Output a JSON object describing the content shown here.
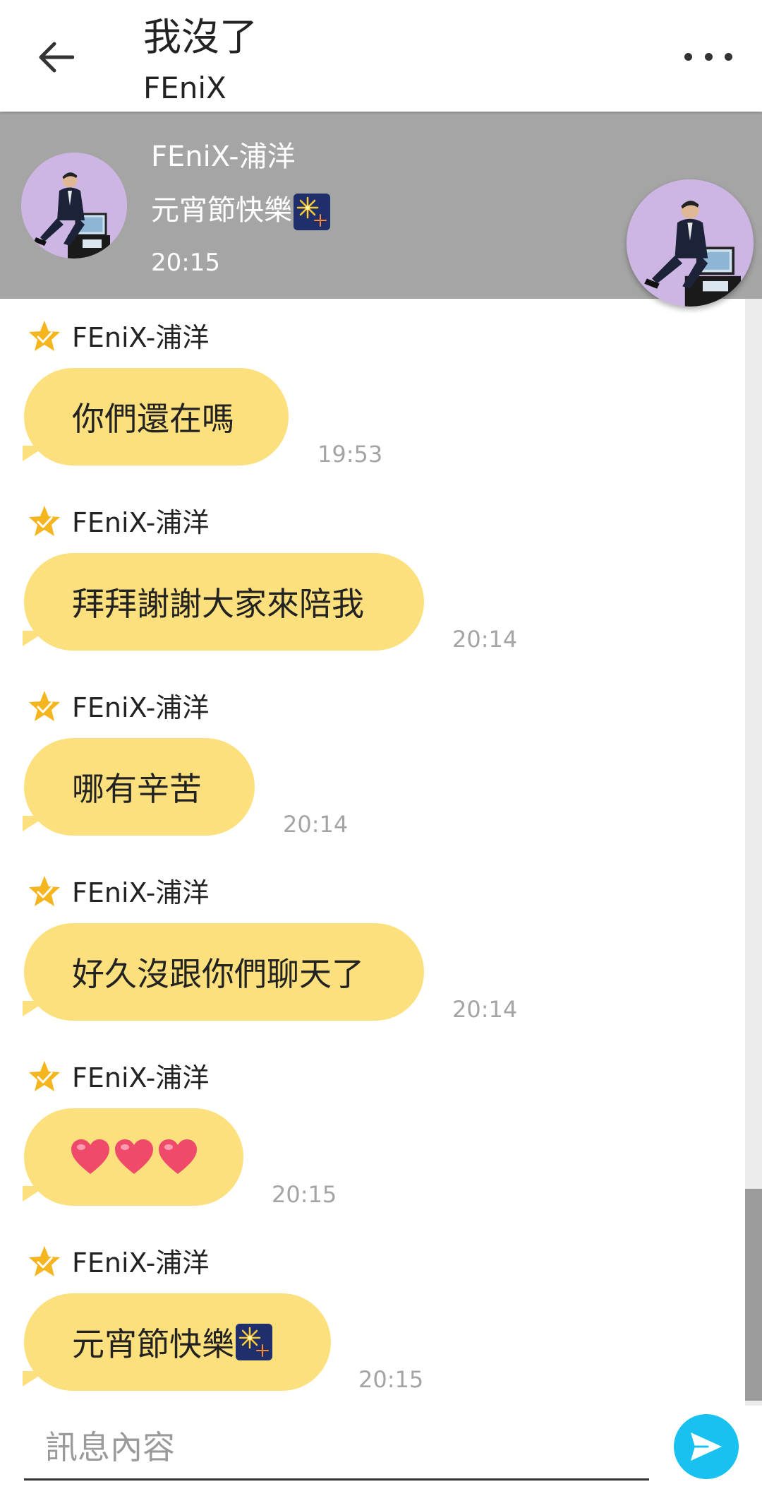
{
  "header": {
    "title": "我沒了",
    "subtitle": "FEniX",
    "back_icon": "arrow-left-icon",
    "more_icon": "more-horizontal-icon"
  },
  "pinned": {
    "name": "FEniX-浦洋",
    "text": "元宵節快樂",
    "text_emoji": "firework-icon",
    "time": "20:15"
  },
  "messages": [
    {
      "sender": "FEniX-浦洋",
      "text": "你們還在嗎",
      "time": "19:53"
    },
    {
      "sender": "FEniX-浦洋",
      "text": "拜拜謝謝大家來陪我",
      "time": "20:14"
    },
    {
      "sender": "FEniX-浦洋",
      "text": "哪有辛苦",
      "time": "20:14"
    },
    {
      "sender": "FEniX-浦洋",
      "text": "好久沒跟你們聊天了",
      "time": "20:14"
    },
    {
      "sender": "FEniX-浦洋",
      "text": "",
      "emoji": "heart-icon ×3",
      "time": "20:15"
    },
    {
      "sender": "FEniX-浦洋",
      "text": "元宵節快樂",
      "emoji": "firework-icon",
      "time": "20:15"
    }
  ],
  "input": {
    "placeholder": "訊息內容",
    "value": ""
  },
  "colors": {
    "bubble": "#fde07e",
    "pinned_bg": "#a5a5a5",
    "send_button": "#19c1f0",
    "star": "#f5b51e",
    "time_text": "#a4a4a4",
    "avatar_bg": "#cdb6e3"
  }
}
